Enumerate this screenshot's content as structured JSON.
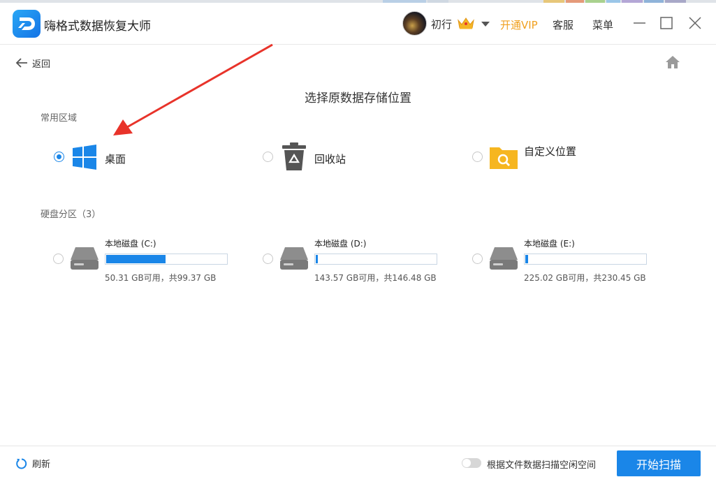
{
  "app": {
    "title": "嗨格式数据恢复大师",
    "username": "初行",
    "vip_label": "开通VIP",
    "service_label": "客服",
    "menu_label": "菜单"
  },
  "nav": {
    "back_label": "返回"
  },
  "page": {
    "title": "选择原数据存储位置"
  },
  "common_area": {
    "label": "常用区域",
    "items": [
      {
        "label": "桌面",
        "icon": "windows-icon",
        "selected": true
      },
      {
        "label": "回收站",
        "icon": "recycle-bin-icon",
        "selected": false
      },
      {
        "label": "自定义位置",
        "icon": "folder-search-icon",
        "selected": false
      }
    ]
  },
  "partitions": {
    "label": "硬盘分区（3）",
    "drives": [
      {
        "name": "本地磁盘 (C:)",
        "space": "50.31 GB可用，共99.37 GB",
        "used_fraction": 0.494
      },
      {
        "name": "本地磁盘 (D:)",
        "space": "143.57 GB可用，共146.48 GB",
        "used_fraction": 0.02
      },
      {
        "name": "本地磁盘 (E:)",
        "space": "225.02 GB可用，共230.45 GB",
        "used_fraction": 0.024
      }
    ]
  },
  "footer": {
    "refresh_label": "刷新",
    "toggle_label": "根据文件数据扫描空闲空间",
    "toggle_on": false,
    "scan_label": "开始扫描"
  },
  "colors": {
    "accent": "#1a86e8",
    "vip": "#f0a020",
    "annotation": "#e8332a"
  }
}
